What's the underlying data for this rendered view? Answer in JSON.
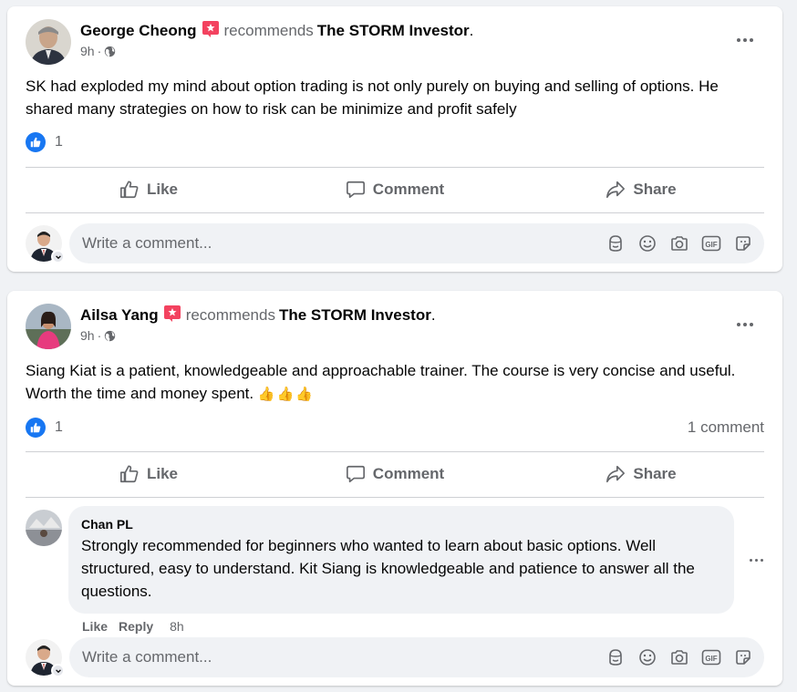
{
  "posts": [
    {
      "author": "George Cheong",
      "verb": "recommends",
      "page": "The STORM Investor",
      "punct": ".",
      "time": "9h",
      "text": "SK had exploded my mind about option trading is not only purely on buying and selling of options. He shared many strategies on how to risk can be minimize and profit safely",
      "emoji": "",
      "like_count": "1",
      "comments_label": ""
    },
    {
      "author": "Ailsa Yang",
      "verb": "recommends",
      "page": "The STORM Investor",
      "punct": ".",
      "time": "9h",
      "text": "Siang Kiat is a patient, knowledgeable and approachable trainer.  The course is very concise and useful. Worth the time and money spent.",
      "emoji": "👍👍👍",
      "like_count": "1",
      "comments_label": "1 comment"
    }
  ],
  "actions": {
    "like": "Like",
    "comment": "Comment",
    "share": "Share"
  },
  "write_placeholder": "Write a comment...",
  "comment": {
    "author": "Chan PL",
    "text": "Strongly recommended for beginners who wanted to learn about basic options. Well structured, easy to understand. Kit Siang is knowledgeable and patience to answer all the questions.",
    "like_label": "Like",
    "reply_label": "Reply",
    "time": "8h"
  },
  "colors": {
    "brand_blue": "#1877f2",
    "secondary_text": "#65676b",
    "badge_red": "#f3425f"
  }
}
